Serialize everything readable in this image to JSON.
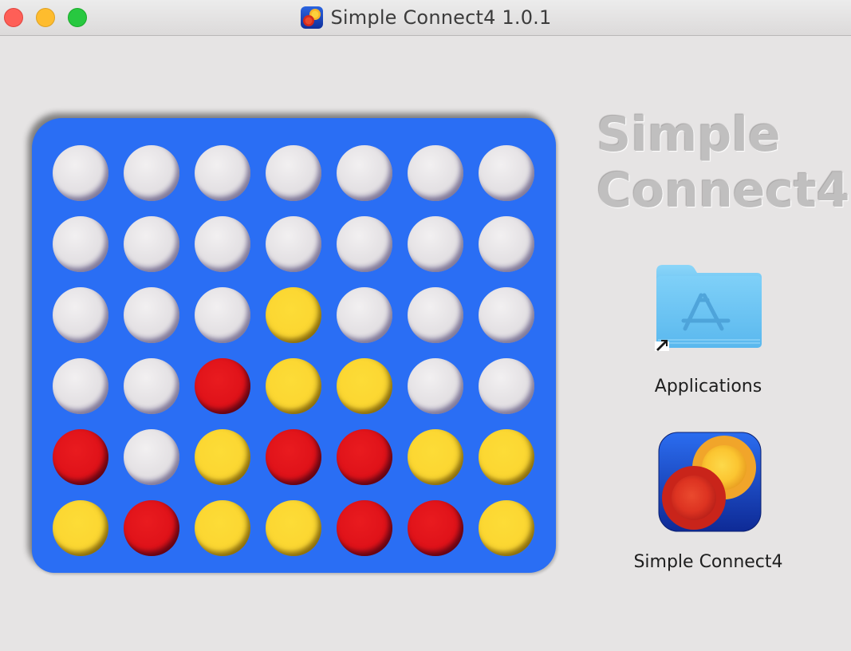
{
  "window": {
    "title": "Simple Connect4 1.0.1"
  },
  "traffic_lights": [
    {
      "name": "close",
      "color": "#fe5f57"
    },
    {
      "name": "minimize",
      "color": "#febc2e"
    },
    {
      "name": "zoom",
      "color": "#28c840"
    }
  ],
  "heading": {
    "line1": "Simple",
    "line2": "Connect4"
  },
  "board": {
    "color": "#2a6ef4",
    "rows": [
      [
        "empty",
        "empty",
        "empty",
        "empty",
        "empty",
        "empty",
        "empty"
      ],
      [
        "empty",
        "empty",
        "empty",
        "empty",
        "empty",
        "empty",
        "empty"
      ],
      [
        "empty",
        "empty",
        "empty",
        "yellow",
        "empty",
        "empty",
        "empty"
      ],
      [
        "empty",
        "empty",
        "red",
        "yellow",
        "yellow",
        "empty",
        "empty"
      ],
      [
        "red",
        "empty",
        "yellow",
        "red",
        "red",
        "yellow",
        "yellow"
      ],
      [
        "yellow",
        "red",
        "yellow",
        "yellow",
        "red",
        "red",
        "yellow"
      ]
    ]
  },
  "items": {
    "applications": {
      "label": "Applications",
      "icon": "app-store-folder-icon"
    },
    "app": {
      "label": "Simple Connect4",
      "icon": "simple-connect4-app-icon"
    }
  },
  "colors": {
    "red_piece": "#df1219",
    "yellow_piece": "#fbd631",
    "empty_slot": "#e3e0e3",
    "background": "#e6e4e4"
  }
}
